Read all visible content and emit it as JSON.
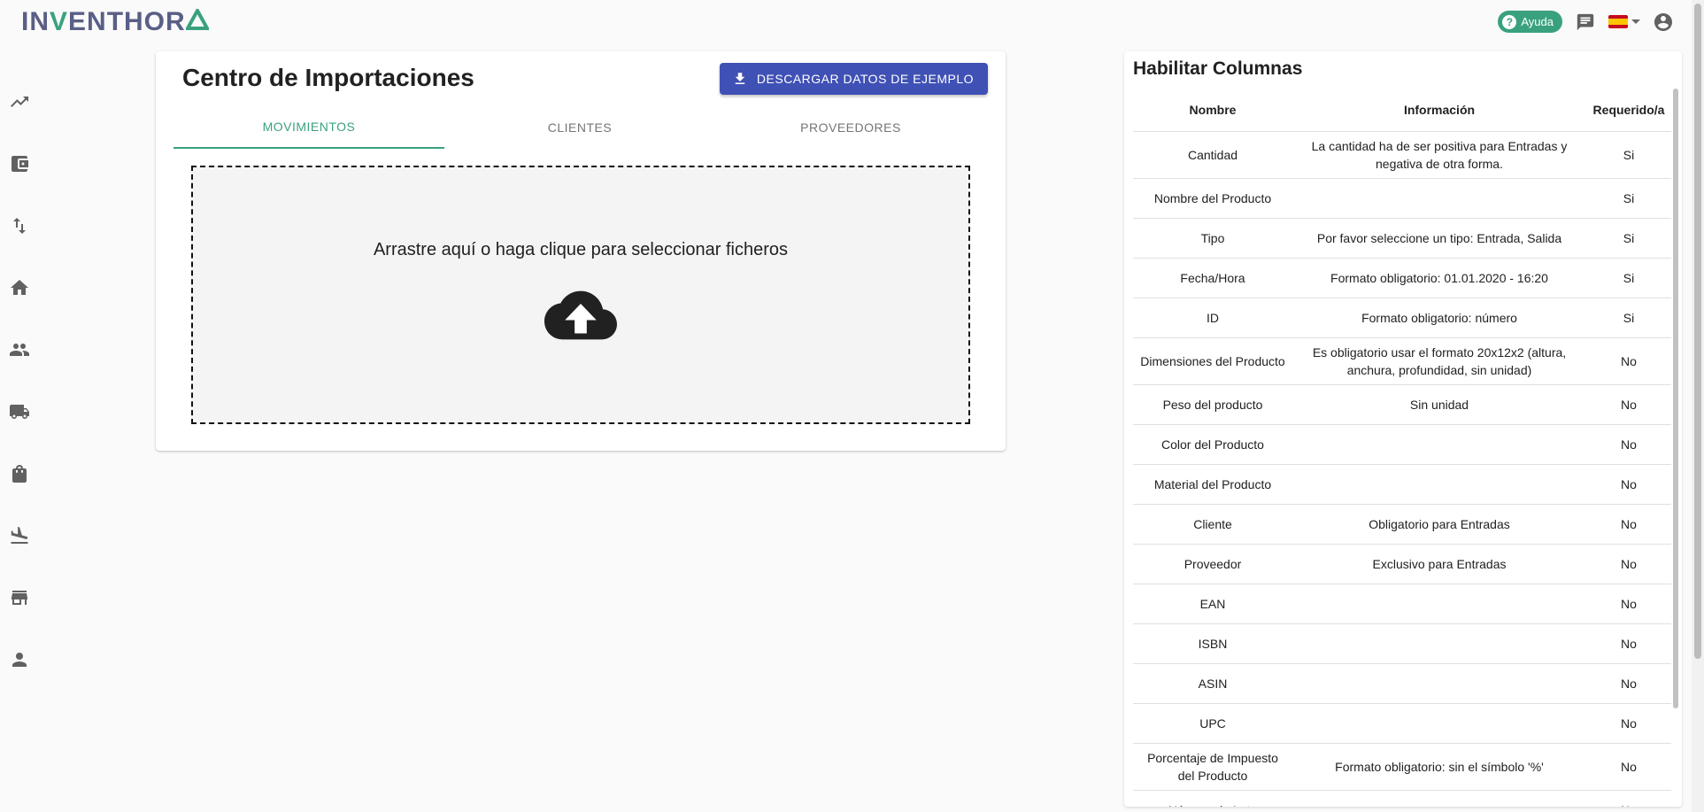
{
  "app": {
    "logo_text": "INVENTHORA",
    "brand_color": "#5a5f86",
    "accent_color": "#3aa17e"
  },
  "topbar": {
    "help_label": "Ayuda",
    "icons": [
      "help-icon",
      "chat-icon",
      "flag-es-icon",
      "account-icon"
    ]
  },
  "sidebar": {
    "items": [
      {
        "icon": "trending-icon"
      },
      {
        "icon": "wallet-icon"
      },
      {
        "icon": "swap-vert-icon"
      },
      {
        "icon": "home-icon"
      },
      {
        "icon": "people-icon"
      },
      {
        "icon": "truck-icon"
      },
      {
        "icon": "bag-icon"
      },
      {
        "icon": "airplane-landing-icon"
      },
      {
        "icon": "store-icon"
      },
      {
        "icon": "person-icon"
      }
    ]
  },
  "main": {
    "title": "Centro de Importaciones",
    "download_label": "DESCARGAR DATOS DE EJEMPLO",
    "tabs": [
      {
        "label": "MOVIMIENTOS",
        "active": true
      },
      {
        "label": "CLIENTES",
        "active": false
      },
      {
        "label": "PROVEEDORES",
        "active": false
      }
    ],
    "dropzone_text": "Arrastre aquí o haga clique para seleccionar ficheros"
  },
  "panel": {
    "title": "Habilitar Columnas",
    "headers": [
      "Nombre",
      "Información",
      "Requerido/a"
    ],
    "rows": [
      {
        "name": "Cantidad",
        "info": "La cantidad ha de ser positiva para Entradas y negativa de otra forma.",
        "req": "Si"
      },
      {
        "name": "Nombre del Producto",
        "info": "",
        "req": "Si"
      },
      {
        "name": "Tipo",
        "info": "Por favor seleccione un tipo: Entrada, Salida",
        "req": "Si"
      },
      {
        "name": "Fecha/Hora",
        "info": "Formato obligatorio: 01.01.2020 - 16:20",
        "req": "Si"
      },
      {
        "name": "ID",
        "info": "Formato obligatorio: número",
        "req": "Si"
      },
      {
        "name": "Dimensiones del Producto",
        "info": "Es obligatorio usar el formato 20x12x2 (altura, anchura, profundidad, sin unidad)",
        "req": "No"
      },
      {
        "name": "Peso del producto",
        "info": "Sin unidad",
        "req": "No"
      },
      {
        "name": "Color del Producto",
        "info": "",
        "req": "No"
      },
      {
        "name": "Material del Producto",
        "info": "",
        "req": "No"
      },
      {
        "name": "Cliente",
        "info": "Obligatorio para Entradas",
        "req": "No"
      },
      {
        "name": "Proveedor",
        "info": "Exclusivo para Entradas",
        "req": "No"
      },
      {
        "name": "EAN",
        "info": "",
        "req": "No"
      },
      {
        "name": "ISBN",
        "info": "",
        "req": "No"
      },
      {
        "name": "ASIN",
        "info": "",
        "req": "No"
      },
      {
        "name": "UPC",
        "info": "",
        "req": "No"
      },
      {
        "name": "Porcentaje de Impuesto del Producto",
        "info": "Formato obligatorio: sin el símbolo '%'",
        "req": "No"
      },
      {
        "name": "Número de Lote",
        "info": "",
        "req": "No"
      }
    ]
  }
}
